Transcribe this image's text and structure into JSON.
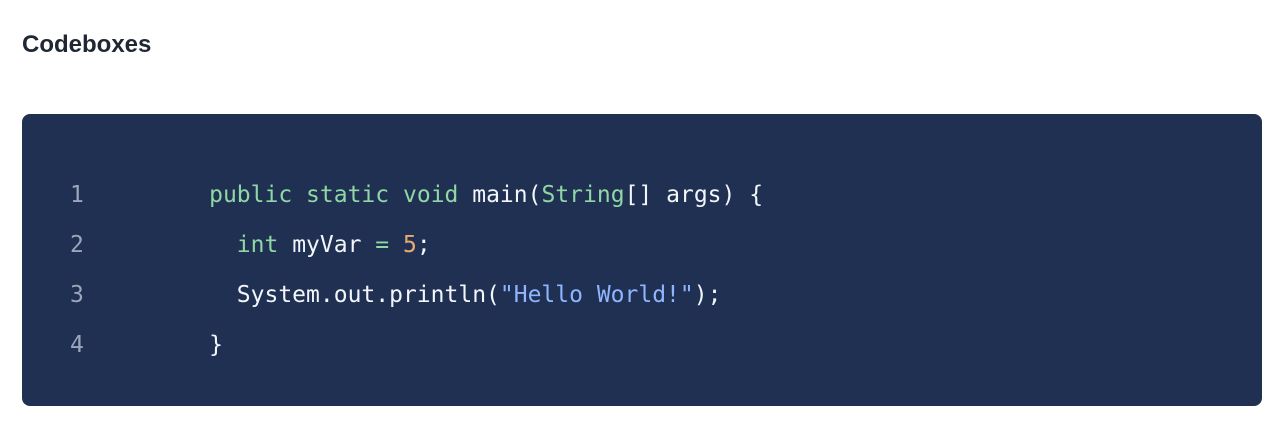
{
  "page": {
    "section_title": "Codeboxes"
  },
  "codebox": {
    "lines": [
      {
        "number": "1",
        "tokens": [
          {
            "text": "public",
            "type": "keyword"
          },
          {
            "text": " ",
            "type": "plain"
          },
          {
            "text": "static",
            "type": "keyword"
          },
          {
            "text": " ",
            "type": "plain"
          },
          {
            "text": "void",
            "type": "keyword"
          },
          {
            "text": " main(",
            "type": "plain"
          },
          {
            "text": "String",
            "type": "type"
          },
          {
            "text": "[] args) {",
            "type": "plain"
          }
        ]
      },
      {
        "number": "2",
        "tokens": [
          {
            "text": "  ",
            "type": "plain"
          },
          {
            "text": "int",
            "type": "keyword"
          },
          {
            "text": " myVar ",
            "type": "plain"
          },
          {
            "text": "=",
            "type": "keyword"
          },
          {
            "text": " ",
            "type": "plain"
          },
          {
            "text": "5",
            "type": "number"
          },
          {
            "text": ";",
            "type": "plain"
          }
        ]
      },
      {
        "number": "3",
        "tokens": [
          {
            "text": "  System.out.println(",
            "type": "plain"
          },
          {
            "text": "\"Hello World!\"",
            "type": "string"
          },
          {
            "text": ");",
            "type": "plain"
          }
        ]
      },
      {
        "number": "4",
        "tokens": [
          {
            "text": "}",
            "type": "plain"
          }
        ]
      }
    ]
  },
  "colors": {
    "background": "#ffffff",
    "title_text": "#1f2733",
    "codebox_background": "#203052",
    "line_number": "#9aa6ba",
    "plain_code": "#f2f5f9",
    "keyword": "#8fd7a5",
    "number": "#e9aa72",
    "string": "#8fb5ff"
  }
}
